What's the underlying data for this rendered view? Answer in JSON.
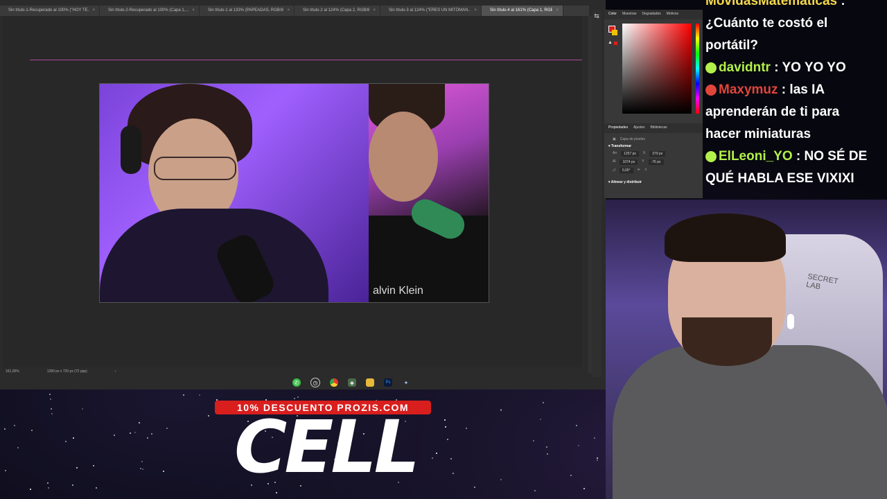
{
  "photoshop": {
    "tabs": [
      {
        "label": "Sin título-1-Recuperado al 100% (\"HOY TE...",
        "active": false
      },
      {
        "label": "Sin título-2-Recuperado al 100% (Capa 1,...",
        "active": false
      },
      {
        "label": "Sin título-1 al 133% (PAPEADAS, RGB/8...",
        "active": false
      },
      {
        "label": "Sin título-2 al 124% (Capa 2, RGB/8...",
        "active": false
      },
      {
        "label": "Sin título-3 al 124% (\"ERES UN MITÓMAN...",
        "active": false
      },
      {
        "label": "Sin título-4 al 161% (Capa 1, RGB/8#) *",
        "active": true
      }
    ],
    "status_zoom": "161,05%",
    "status_doc": "1280 px x 720 px (72 ppp)",
    "panel": {
      "top_tabs": [
        "Color",
        "Muestras",
        "Degradados",
        "Motivos"
      ],
      "color_fg": "#e31b1b",
      "color_bg": "#f2c400",
      "props_tabs": [
        "Propiedades",
        "Ajustes",
        "Bibliotecas"
      ],
      "layer_type": "Capa de píxeles",
      "transform_title": "Transformar",
      "an_label": "An",
      "an_value": "1257 px",
      "x_label": "X",
      "x_value": "379 px",
      "al_label": "Al",
      "al_value": "1074 px",
      "y_label": "Y",
      "y_value": "-76 px",
      "angle_value": "0,00°",
      "align_title": "Alinear y distribuir"
    }
  },
  "taskbar_icons": [
    "whatsapp-icon",
    "clock-icon",
    "chrome-icon",
    "app-icon",
    "folder-icon",
    "photoshop-icon",
    "bird-icon"
  ],
  "chat": {
    "lines": [
      {
        "user": "MovidasMatematicas",
        "sep": " :",
        "text": "",
        "user_color": "#f5d94a"
      },
      {
        "user": "",
        "sep": "",
        "text": "¿Cuánto te costó el",
        "user_color": ""
      },
      {
        "user": "",
        "sep": "",
        "text": "portátil?",
        "user_color": ""
      },
      {
        "user": "davidntr",
        "sep": " : ",
        "text": "YO YO YO",
        "user_color": "#b2f04a"
      },
      {
        "user": "Maxymuz",
        "sep": " : ",
        "text": "las IA",
        "user_color": "#e0453a"
      },
      {
        "user": "",
        "sep": "",
        "text": "aprenderán de ti para",
        "user_color": ""
      },
      {
        "user": "",
        "sep": "",
        "text": "hacer miniaturas",
        "user_color": ""
      },
      {
        "user": "ElLeoni_YO",
        "sep": " : ",
        "text": "NO SÉ DE",
        "user_color": "#b2f04a"
      },
      {
        "user": "",
        "sep": "",
        "text": "QUÉ HABLA ESE VIXIXI",
        "user_color": ""
      }
    ]
  },
  "webcam": {
    "chair_text": "SECRET LAB"
  },
  "promo": {
    "banner": "10% DESCUENTO PROZIS.COM",
    "logo": "CELL"
  },
  "artboard": {
    "shirt_text": "alvin Klein"
  }
}
